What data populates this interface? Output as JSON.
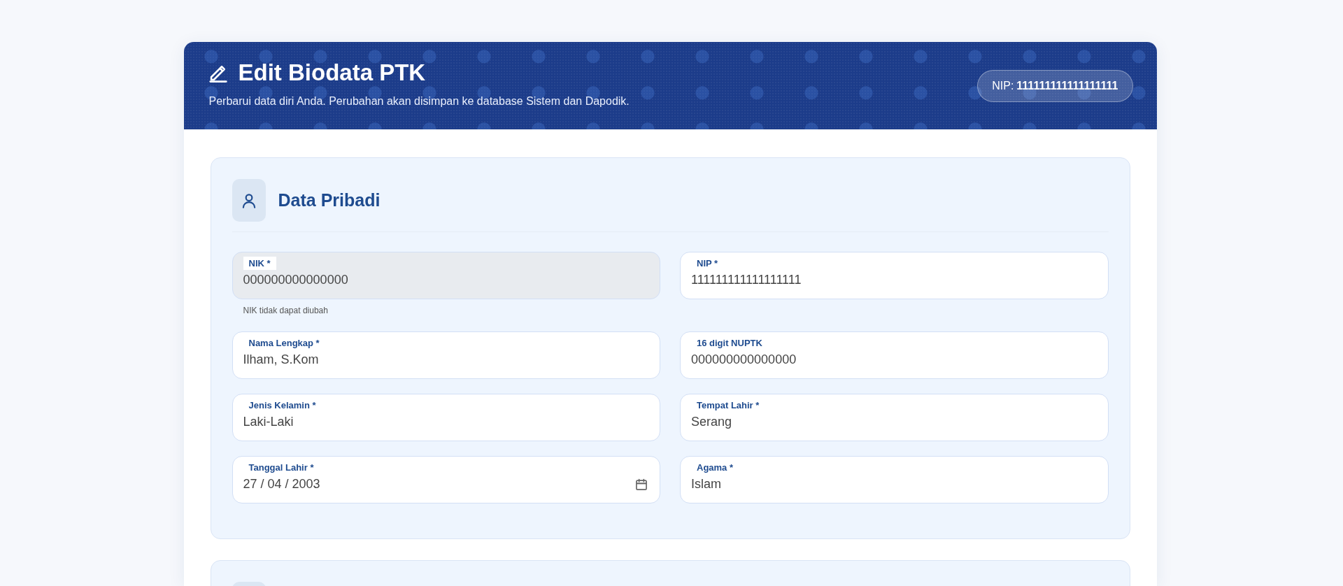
{
  "header": {
    "title": "Edit Biodata PTK",
    "subtitle": "Perbarui data diri Anda. Perubahan akan disimpan ke database Sistem dan Dapodik.",
    "badge": {
      "label": "NIP:",
      "value": "111111111111111111"
    }
  },
  "sections": [
    {
      "title": "Data Pribadi",
      "fields": [
        {
          "kind": "text",
          "label": "NIK *",
          "value": "000000000000000",
          "disabled": true,
          "hint": "NIK tidak dapat diubah"
        },
        {
          "kind": "text",
          "label": "NIP *",
          "value": "111111111111111111",
          "disabled": false
        },
        {
          "kind": "text",
          "label": "Nama Lengkap *",
          "value": "Ilham, S.Kom",
          "disabled": false
        },
        {
          "kind": "text",
          "label": "16 digit NUPTK",
          "value": "000000000000000",
          "disabled": false
        },
        {
          "kind": "text",
          "label": "Jenis Kelamin *",
          "value": "Laki-Laki",
          "disabled": false
        },
        {
          "kind": "text",
          "label": "Tempat Lahir *",
          "value": "Serang",
          "disabled": false
        },
        {
          "kind": "date",
          "label": "Tanggal Lahir *",
          "value": "27 / 04 / 2003",
          "disabled": false
        },
        {
          "kind": "text",
          "label": "Agama *",
          "value": "Islam",
          "disabled": false
        }
      ]
    }
  ],
  "more_below": true
}
